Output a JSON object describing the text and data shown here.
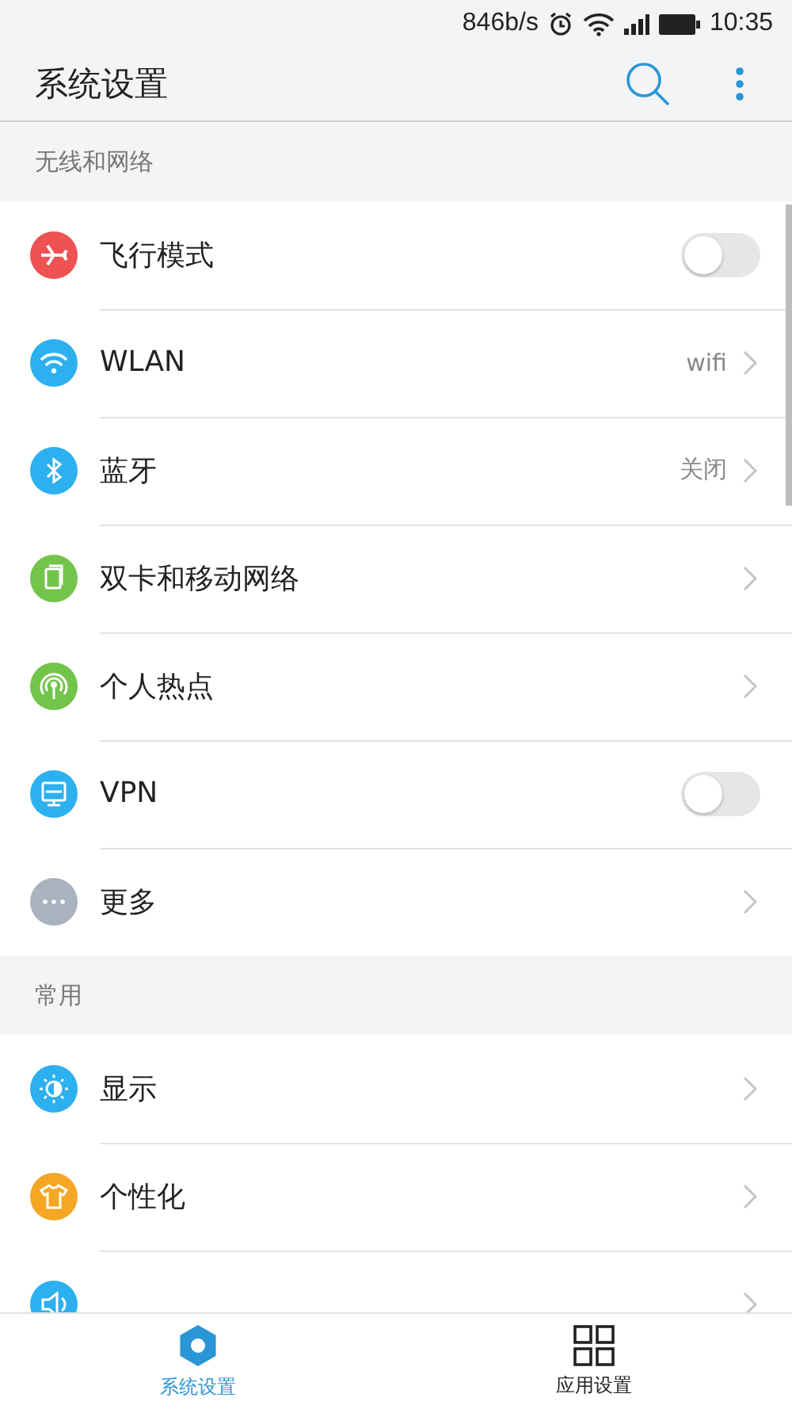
{
  "status_bar": {
    "speed": "846b/s",
    "time": "10:35"
  },
  "header": {
    "title": "系统设置"
  },
  "sections": [
    {
      "title": "无线和网络",
      "rows": [
        {
          "kind": "toggle",
          "label": "飞行模式",
          "color": "#ee5253",
          "on": false
        },
        {
          "kind": "link",
          "label": "WLAN",
          "color": "#2db0ef",
          "value": "wifi"
        },
        {
          "kind": "link",
          "label": "蓝牙",
          "color": "#2db0ef",
          "value": "关闭"
        },
        {
          "kind": "link",
          "label": "双卡和移动网络",
          "color": "#72c44a"
        },
        {
          "kind": "link",
          "label": "个人热点",
          "color": "#72c44a"
        },
        {
          "kind": "toggle",
          "label": "VPN",
          "color": "#2db0ef",
          "on": false
        },
        {
          "kind": "link",
          "label": "更多",
          "color": "#a9b3bd"
        }
      ]
    },
    {
      "title": "常用",
      "rows": [
        {
          "kind": "link",
          "label": "显示",
          "color": "#2db0ef"
        },
        {
          "kind": "link",
          "label": "个性化",
          "color": "#f5a623"
        },
        {
          "kind": "link",
          "color": "#2db0ef"
        }
      ]
    }
  ],
  "bottom_nav": [
    {
      "label": "系统设置",
      "selected": true
    },
    {
      "label": "应用设置",
      "selected": false
    }
  ]
}
